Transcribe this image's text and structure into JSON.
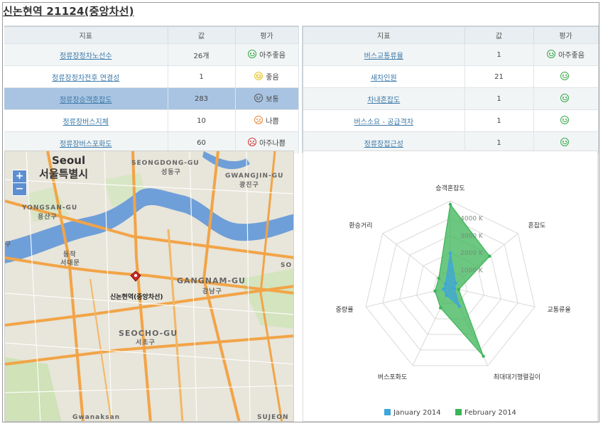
{
  "title": "신논현역 21124(중앙차선)",
  "headers": {
    "indicator": "지표",
    "value": "값",
    "grade": "평가"
  },
  "left_table": [
    {
      "name": "정류장정차노선수",
      "value": "26개",
      "grade": "아주좋음",
      "face": "smile",
      "color": "#3aa84a"
    },
    {
      "name": "정류장정차전후 연결성",
      "value": "1",
      "grade": "좋음",
      "face": "smile",
      "color": "#e3c94b"
    },
    {
      "name": "정류장승객혼잡도",
      "value": "283",
      "grade": "보통",
      "face": "flat",
      "color": "#555555"
    },
    {
      "name": "정류장버스지체",
      "value": "10",
      "grade": "나쁨",
      "face": "frown",
      "color": "#e88a3a"
    },
    {
      "name": "정류장버스포화도",
      "value": "60",
      "grade": "아주나쁨",
      "face": "frown",
      "color": "#d73a3a"
    }
  ],
  "right_table": [
    {
      "name": "버스교통류율",
      "value": "1",
      "grade": "아주좋음",
      "face": "smile",
      "color": "#3aa84a"
    },
    {
      "name": "새차인원",
      "value": "21",
      "grade": "",
      "face": "smile",
      "color": "#3aa84a"
    },
    {
      "name": "차내혼잡도",
      "value": "1",
      "grade": "",
      "face": "smile",
      "color": "#3aa84a"
    },
    {
      "name": "버스소요 - 공급격차",
      "value": "1",
      "grade": "",
      "face": "smile",
      "color": "#3aa84a"
    },
    {
      "name": "정류장접근성",
      "value": "1",
      "grade": "",
      "face": "smile",
      "color": "#3aa84a"
    }
  ],
  "map": {
    "zoom_in": "+",
    "zoom_out": "−",
    "labels": {
      "seoul_en": "Seoul",
      "seoul_ko": "서울특별시",
      "seongdong_en": "SEONGDONG-GU",
      "seongdong_ko": "성동구",
      "gwangjin_en": "GWANGJIN-GU",
      "gwangjin_ko": "광진구",
      "yongsan_en": "YONGSAN-GU",
      "yongsan_ko": "용산구",
      "gangnam_en": "GANGNAM-GU",
      "gangnam_ko": "강남구",
      "seocho_en": "SEOCHO-GU",
      "seocho_ko": "서초구",
      "sujeon": "SUJEON",
      "so": "SO",
      "dongjak_a": "동작",
      "dongjak_b": "서대문",
      "left_edge": "구",
      "bottom_left": "Gwanaksan",
      "marker_label": "신논현역(중앙차선)"
    }
  },
  "chart_data": {
    "type": "radar",
    "categories": [
      "승객혼잡도",
      "혼잡도",
      "교통류율",
      "최대대기행렬길이",
      "버스포화도",
      "중량률",
      "환승거리"
    ],
    "radial_ticks": [
      "1000 K",
      "2000 K",
      "3000 K",
      "4000 K"
    ],
    "rmax": 5000,
    "series": [
      {
        "name": "January 2014",
        "color": "#3ea6da",
        "values": [
          2000,
          400,
          250,
          1200,
          500,
          400,
          350
        ]
      },
      {
        "name": "February 2014",
        "color": "#3bb457",
        "values": [
          4800,
          2900,
          500,
          4400,
          1300,
          900,
          850
        ]
      }
    ],
    "grid": true,
    "legend": "bottom"
  }
}
